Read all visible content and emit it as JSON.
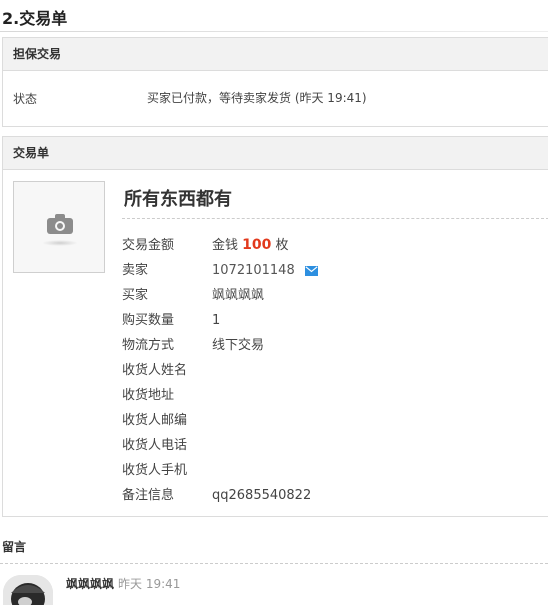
{
  "page_title": "2.交易单",
  "guarantee": {
    "header": "担保交易",
    "status_label": "状态",
    "status_value": "买家已付款，等待卖家发货 (昨天 19:41)"
  },
  "order": {
    "header": "交易单",
    "goods_name": "所有东西都有",
    "amount_label": "交易金额",
    "amount_prefix": "金钱",
    "amount_value": "100",
    "amount_unit": "枚",
    "seller_label": "卖家",
    "seller_value": "1072101148",
    "buyer_label": "买家",
    "buyer_value": "飒飒飒飒",
    "qty_label": "购买数量",
    "qty_value": "1",
    "logistics_label": "物流方式",
    "logistics_value": "线下交易",
    "recv_name_label": "收货人姓名",
    "recv_addr_label": "收货地址",
    "recv_zip_label": "收货人邮编",
    "recv_phone_label": "收货人电话",
    "recv_mobile_label": "收货人手机",
    "note_label": "备注信息",
    "note_value": "qq2685540822"
  },
  "messages": {
    "header": "留言",
    "items": [
      {
        "user": "飒飒飒飒",
        "time": "昨天 19:41",
        "avatar_icon": "user-avatar"
      }
    ]
  },
  "icons": {
    "thumbnail": "camera-icon",
    "seller_contact": "mail-icon"
  },
  "colors": {
    "price": "#e2391c",
    "mail_icon": "#2d8fe0",
    "panel_header_bg": "#f2f2f2"
  }
}
